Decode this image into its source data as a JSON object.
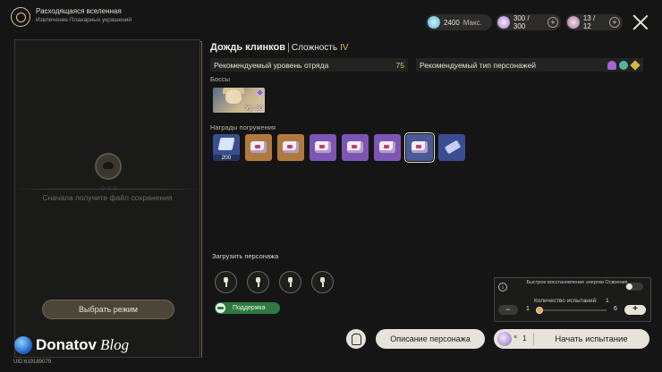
{
  "header": {
    "title": "Расходящаяся вселенная",
    "subtitle": "Извлечение Планарных украшений"
  },
  "resources": {
    "power": "2400",
    "power_max": "Макс.",
    "stamina": "300 / 300",
    "fuel": "13 / 12"
  },
  "left_panel": {
    "hint": "Сначала получите файл сохранения",
    "mode_button": "Выбрать режим"
  },
  "stage": {
    "name": "Дождь клинков",
    "difficulty_label": "Сложность",
    "difficulty_value": "IV",
    "recommended_level_label": "Рекомендуемый уровень отряда",
    "recommended_level": "75",
    "recommended_type_label": "Рекомендуемый тип персонажей",
    "recommended_elements": [
      "imaginary-icon",
      "wind-icon",
      "quantum-icon"
    ],
    "element_colors": [
      "#a266d6",
      "#4fb6a2",
      "#d5b840"
    ]
  },
  "bosses": {
    "label": "Боссы",
    "items": [
      {
        "level": "Ур. 80"
      }
    ]
  },
  "rewards": {
    "label": "Награды погружения",
    "items": [
      {
        "icon": "exp-material-icon",
        "count": "200",
        "bg": "#3a4d8f"
      },
      {
        "icon": "relic-sphere-icon",
        "count": "",
        "bg": "#b07a3e"
      },
      {
        "icon": "relic-sphere-icon",
        "count": "",
        "bg": "#b07a3e"
      },
      {
        "icon": "relic-sphere-icon",
        "count": "",
        "bg": "#7d56b5"
      },
      {
        "icon": "relic-sphere-icon",
        "count": "",
        "bg": "#7d56b5"
      },
      {
        "icon": "relic-sphere-icon",
        "count": "",
        "bg": "#7d56b5"
      },
      {
        "icon": "relic-sphere-icon",
        "count": "",
        "bg": "#4a5a96"
      },
      {
        "icon": "relic-rope-icon",
        "count": "",
        "bg": "#3b4d92"
      }
    ]
  },
  "team": {
    "label": "Загрузить персонажа",
    "support": "Поддержка"
  },
  "options": {
    "fast_recovery": "Быстрое восстановление энергии Освоения",
    "count_label": "Количество испытаний:",
    "count_value": "1",
    "min": "1",
    "max": "6",
    "minus": "−",
    "plus": "+"
  },
  "buttons": {
    "character_info": "Описание персонажа",
    "start": "Начать испытание",
    "cost_prefix": "×",
    "cost": "1"
  },
  "watermark": {
    "brand": "Donatov",
    "suffix": "Blog"
  },
  "uid": "UID:619189079"
}
